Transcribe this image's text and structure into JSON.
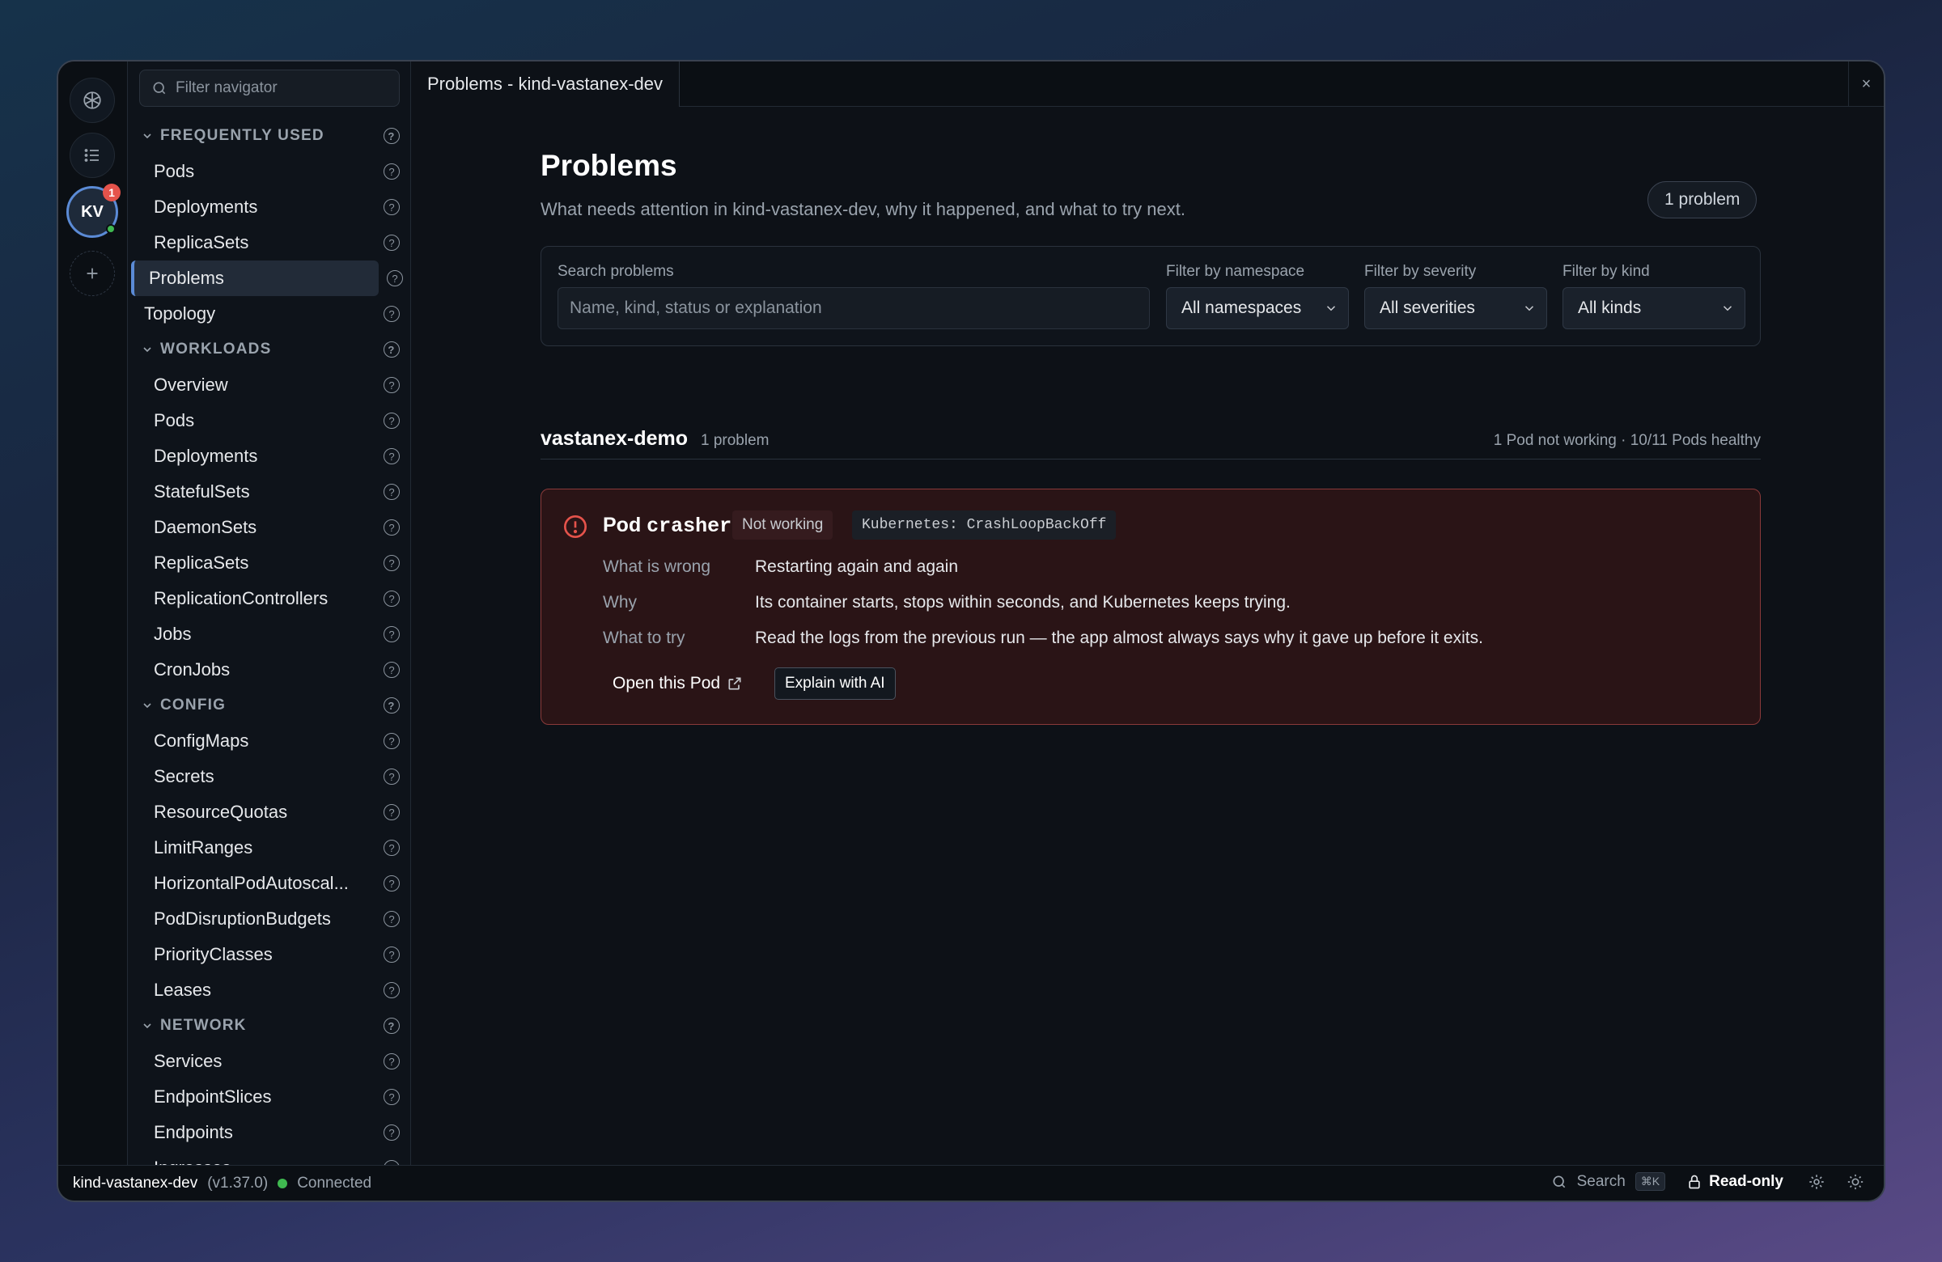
{
  "rail": {
    "avatar_initials": "KV",
    "avatar_badge": "1"
  },
  "navigator": {
    "search_placeholder": "Filter navigator",
    "top_items": [
      {
        "type": "section",
        "label": "FREQUENTLY USED"
      },
      {
        "type": "item",
        "label": "Pods"
      },
      {
        "type": "item",
        "label": "Deployments"
      },
      {
        "type": "item",
        "label": "ReplicaSets"
      },
      {
        "type": "active",
        "label": "Problems"
      },
      {
        "type": "top",
        "label": "Topology"
      },
      {
        "type": "section",
        "label": "WORKLOADS"
      },
      {
        "type": "item",
        "label": "Overview"
      },
      {
        "type": "item",
        "label": "Pods"
      },
      {
        "type": "item",
        "label": "Deployments"
      },
      {
        "type": "item",
        "label": "StatefulSets"
      },
      {
        "type": "item",
        "label": "DaemonSets"
      },
      {
        "type": "item",
        "label": "ReplicaSets"
      },
      {
        "type": "item",
        "label": "ReplicationControllers"
      },
      {
        "type": "item",
        "label": "Jobs"
      },
      {
        "type": "item",
        "label": "CronJobs"
      },
      {
        "type": "section",
        "label": "CONFIG"
      },
      {
        "type": "item",
        "label": "ConfigMaps"
      },
      {
        "type": "item",
        "label": "Secrets"
      },
      {
        "type": "item",
        "label": "ResourceQuotas"
      },
      {
        "type": "item",
        "label": "LimitRanges"
      },
      {
        "type": "item",
        "label": "HorizontalPodAutoscal..."
      },
      {
        "type": "item",
        "label": "PodDisruptionBudgets"
      },
      {
        "type": "item",
        "label": "PriorityClasses"
      },
      {
        "type": "item",
        "label": "Leases"
      },
      {
        "type": "section",
        "label": "NETWORK"
      },
      {
        "type": "item",
        "label": "Services"
      },
      {
        "type": "item",
        "label": "EndpointSlices"
      },
      {
        "type": "item",
        "label": "Endpoints"
      },
      {
        "type": "item",
        "label": "Ingresses"
      }
    ]
  },
  "tab": {
    "title": "Problems - kind-vastanex-dev",
    "close": "×"
  },
  "page": {
    "title": "Problems",
    "subtitle": "What needs attention in kind-vastanex-dev, why it happened, and what to try next.",
    "count_pill": "1 problem"
  },
  "filters": {
    "search_label": "Search problems",
    "search_placeholder": "Name, kind, status or explanation",
    "namespace_label": "Filter by namespace",
    "namespace_value": "All namespaces",
    "severity_label": "Filter by severity",
    "severity_value": "All severities",
    "kind_label": "Filter by kind",
    "kind_value": "All kinds"
  },
  "group": {
    "name": "vastanex-demo",
    "count": "1 problem",
    "health": "1 Pod not working · 10/11 Pods healthy"
  },
  "problem": {
    "kind": "Pod",
    "name": "crasher",
    "status": "Not working",
    "reason": "Kubernetes: CrashLoopBackOff",
    "what_label": "What is wrong",
    "what_value": "Restarting again and again",
    "why_label": "Why",
    "why_value": "Its container starts, stops within seconds, and Kubernetes keeps trying.",
    "try_label": "What to try",
    "try_value": "Read the logs from the previous run — the app almost always says why it gave up before it exits.",
    "open_label": "Open this Pod",
    "ai_label": "Explain with AI"
  },
  "statusbar": {
    "cluster": "kind-vastanex-dev",
    "version": "(v1.37.0)",
    "connection": "Connected",
    "search_label": "Search",
    "search_shortcut": "⌘K",
    "readonly_label": "Read-only"
  },
  "colors": {
    "accent": "#5b8bd6",
    "danger": "#e5534b",
    "success": "#3fb950"
  }
}
